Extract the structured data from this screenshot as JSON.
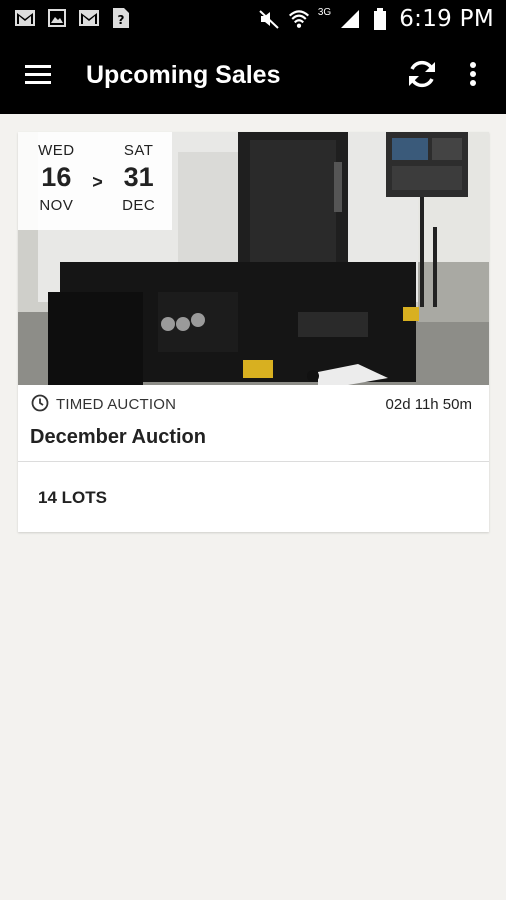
{
  "status_bar": {
    "time": "6:19 PM",
    "network": "3G",
    "left_icons": [
      "gmail-icon",
      "gallery-icon",
      "gmail-icon",
      "unknown-file-icon"
    ],
    "right_icons": [
      "mute-icon",
      "wifi-icon",
      "signal-icon",
      "battery-icon"
    ]
  },
  "app_bar": {
    "title": "Upcoming Sales",
    "icons": [
      "menu-icon",
      "refresh-icon",
      "more-vert-icon"
    ]
  },
  "sale": {
    "start": {
      "day": "WED",
      "date": "16",
      "month": "NOV"
    },
    "separator": ">",
    "end": {
      "day": "SAT",
      "date": "31",
      "month": "DEC"
    },
    "type": "TIMED AUCTION",
    "countdown": "02d 11h 50m",
    "name": "December Auction",
    "lots": "14 LOTS"
  },
  "colors": {
    "app_bar_bg": "#000000",
    "page_bg": "#f3f2ef",
    "card_bg": "#ffffff"
  }
}
